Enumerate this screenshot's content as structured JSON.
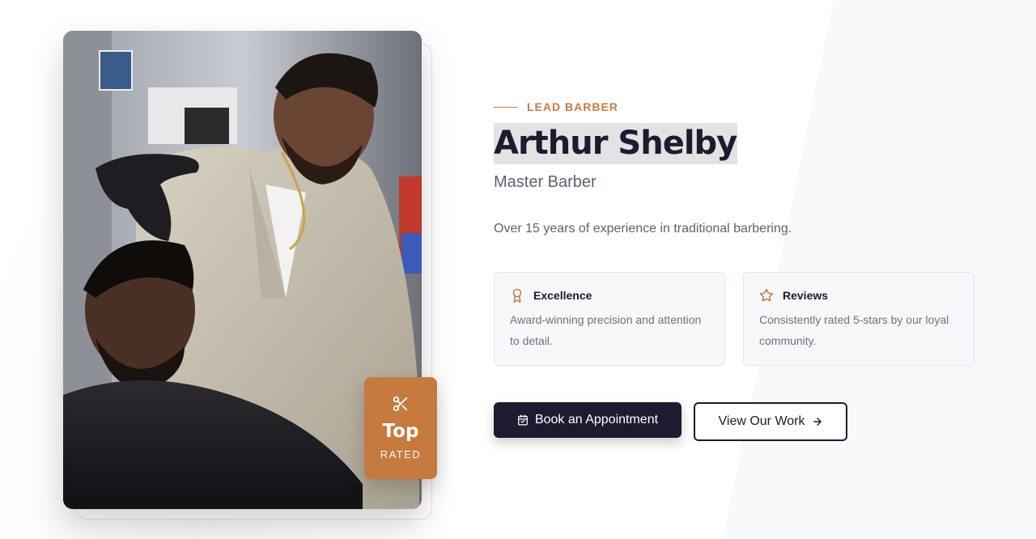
{
  "profile": {
    "eyebrow": "LEAD BARBER",
    "name": "Arthur Shelby",
    "role": "Master Barber",
    "description": "Over 15 years of experience in traditional barbering."
  },
  "badge": {
    "icon": "scissors-icon",
    "title": "Top",
    "subtitle": "RATED"
  },
  "features": [
    {
      "icon": "award-icon",
      "title": "Excellence",
      "text": "Award-winning precision and attention to detail."
    },
    {
      "icon": "star-icon",
      "title": "Reviews",
      "text": "Consistently rated 5-stars by our loyal community."
    }
  ],
  "actions": {
    "primary_label": "Book an Appointment",
    "primary_icon": "calendar-icon",
    "secondary_label": "View Our Work",
    "secondary_icon": "arrow-right-icon"
  },
  "colors": {
    "accent": "#c67a3e",
    "dark": "#1c1b30",
    "muted_text": "#5b6372"
  }
}
